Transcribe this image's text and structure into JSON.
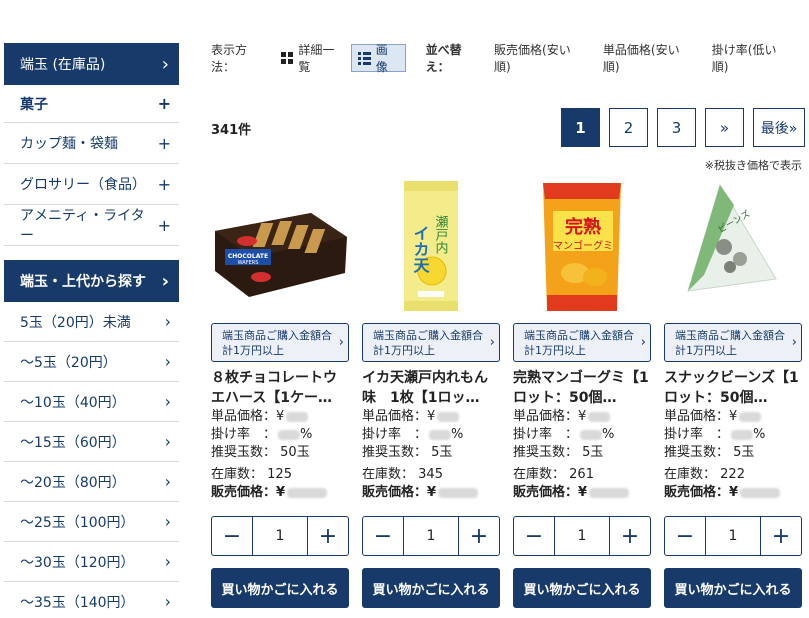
{
  "sidebar": {
    "section1_title": "端玉 (在庫品)",
    "categories": [
      {
        "label": "菓子"
      },
      {
        "label": "カップ麺・袋麺"
      },
      {
        "label": "グロサリー（食品）"
      },
      {
        "label": "アメニティ・ライター"
      }
    ],
    "section2_title": "端玉・上代から探す",
    "price_ranges": [
      {
        "label": "5玉（20円）未満"
      },
      {
        "label": "～5玉（20円）"
      },
      {
        "label": "～10玉（40円）"
      },
      {
        "label": "～15玉（60円）"
      },
      {
        "label": "～20玉（80円）"
      },
      {
        "label": "～25玉（100円）"
      },
      {
        "label": "～30玉（120円）"
      },
      {
        "label": "～35玉（140円）"
      }
    ]
  },
  "toolbar": {
    "view_label": "表示方法：",
    "view_list": "詳細一覧",
    "view_image": "画像",
    "sort_label": "並べ替え：",
    "sort_options": [
      "販売価格(安い順)",
      "単品価格(安い順)",
      "掛け率(低い順)"
    ]
  },
  "results": {
    "count": "341件",
    "tax_note": "※税抜き価格で表示"
  },
  "pager": {
    "pages": [
      "1",
      "2",
      "3"
    ],
    "next": "»",
    "last": "最後»"
  },
  "products": [
    {
      "promo": "端玉商品ご購入金額合計1万円以上",
      "name": "８枚チョコレートウエハース【1ケー…",
      "unit_price_label": "単品価格：¥",
      "rate_label": "掛け率　：",
      "rate_unit": "%",
      "recommend": "推奨玉数：",
      "recommend_value": "50玉",
      "stock_label": "在庫数：",
      "stock_value": "125",
      "sale_label": "販売価格：¥",
      "qty": "1",
      "cart": "買い物かごに入れる",
      "image": "chocolate-wafers-box"
    },
    {
      "promo": "端玉商品ご購入金額合計1万円以上",
      "name": "イカ天瀬戸内れもん味　1枚【1ロッ…",
      "unit_price_label": "単品価格：¥",
      "rate_label": "掛け率　：",
      "rate_unit": "%",
      "recommend": "推奨玉数：",
      "recommend_value": "5玉",
      "stock_label": "在庫数：",
      "stock_value": "345",
      "sale_label": "販売価格：¥",
      "qty": "1",
      "cart": "買い物かごに入れる",
      "image": "ika-ten-lemon-pack"
    },
    {
      "promo": "端玉商品ご購入金額合計1万円以上",
      "name": "完熟マンゴーグミ【1ロット：50個…",
      "unit_price_label": "単品価格：¥",
      "rate_label": "掛け率　：",
      "rate_unit": "%",
      "recommend": "推奨玉数：",
      "recommend_value": "5玉",
      "stock_label": "在庫数：",
      "stock_value": "261",
      "sale_label": "販売価格：¥",
      "qty": "1",
      "cart": "買い物かごに入れる",
      "image": "mango-gummy-pack"
    },
    {
      "promo": "端玉商品ご購入金額合計1万円以上",
      "name": "スナックビーンズ【1ロット：50個…",
      "unit_price_label": "単品価格：¥",
      "rate_label": "掛け率　：",
      "rate_unit": "%",
      "recommend": "推奨玉数：",
      "recommend_value": "5玉",
      "stock_label": "在庫数：",
      "stock_value": "222",
      "sale_label": "販売価格：¥",
      "qty": "1",
      "cart": "買い物かごに入れる",
      "image": "snack-beans-pack"
    }
  ],
  "colors": {
    "navy": "#173a6b",
    "promo_bg": "#edf1f7"
  }
}
